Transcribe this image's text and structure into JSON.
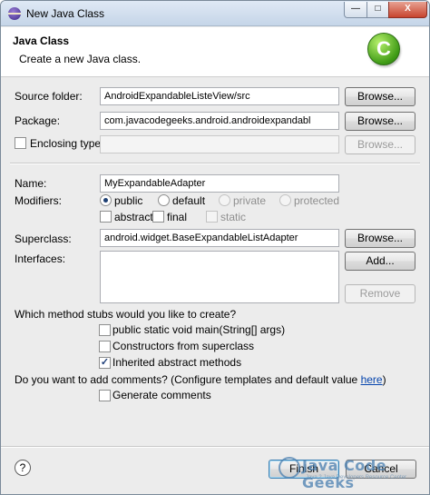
{
  "window": {
    "title": "New Java Class",
    "controls": {
      "minimize": "—",
      "maximize": "□",
      "close": "X"
    }
  },
  "header": {
    "title": "Java Class",
    "description": "Create a new Java class.",
    "icon_letter": "C",
    "icon": "java-class-wizard-icon"
  },
  "form": {
    "source_folder": {
      "label": "Source folder:",
      "value": "AndroidExpandableListeView/src",
      "browse": "Browse..."
    },
    "package": {
      "label": "Package:",
      "value": "com.javacodegeeks.android.androidexpandabl",
      "browse": "Browse..."
    },
    "enclosing_type": {
      "label": "Enclosing type:",
      "value": "",
      "browse": "Browse...",
      "checked": false
    },
    "name": {
      "label": "Name:",
      "value": "MyExpandableAdapter"
    },
    "modifiers": {
      "label": "Modifiers:",
      "options": {
        "public": "public",
        "default": "default",
        "private": "private",
        "protected": "protected"
      },
      "selected": "public",
      "flags": {
        "abstract": "abstract",
        "final": "final",
        "static": "static"
      }
    },
    "superclass": {
      "label": "Superclass:",
      "value": "android.widget.BaseExpandableListAdapter",
      "browse": "Browse..."
    },
    "interfaces": {
      "label": "Interfaces:",
      "add": "Add...",
      "remove": "Remove"
    }
  },
  "stubs": {
    "question": "Which method stubs would you like to create?",
    "main": "public static void main(String[] args)",
    "constructors": "Constructors from superclass",
    "inherited": "Inherited abstract methods",
    "inherited_checked": true
  },
  "comments": {
    "question": "Do you want to add comments? (Configure templates and default value ",
    "link": "here",
    "question_end": ")",
    "generate": "Generate comments"
  },
  "footer": {
    "help": "?",
    "finish": "Finish",
    "cancel": "Cancel"
  },
  "watermark": {
    "text": "Java Code Geeks",
    "tagline": "Java 2 Java Developers Resource Center"
  },
  "colors": {
    "accent_green": "#3f9b16",
    "link": "#0645ad"
  }
}
